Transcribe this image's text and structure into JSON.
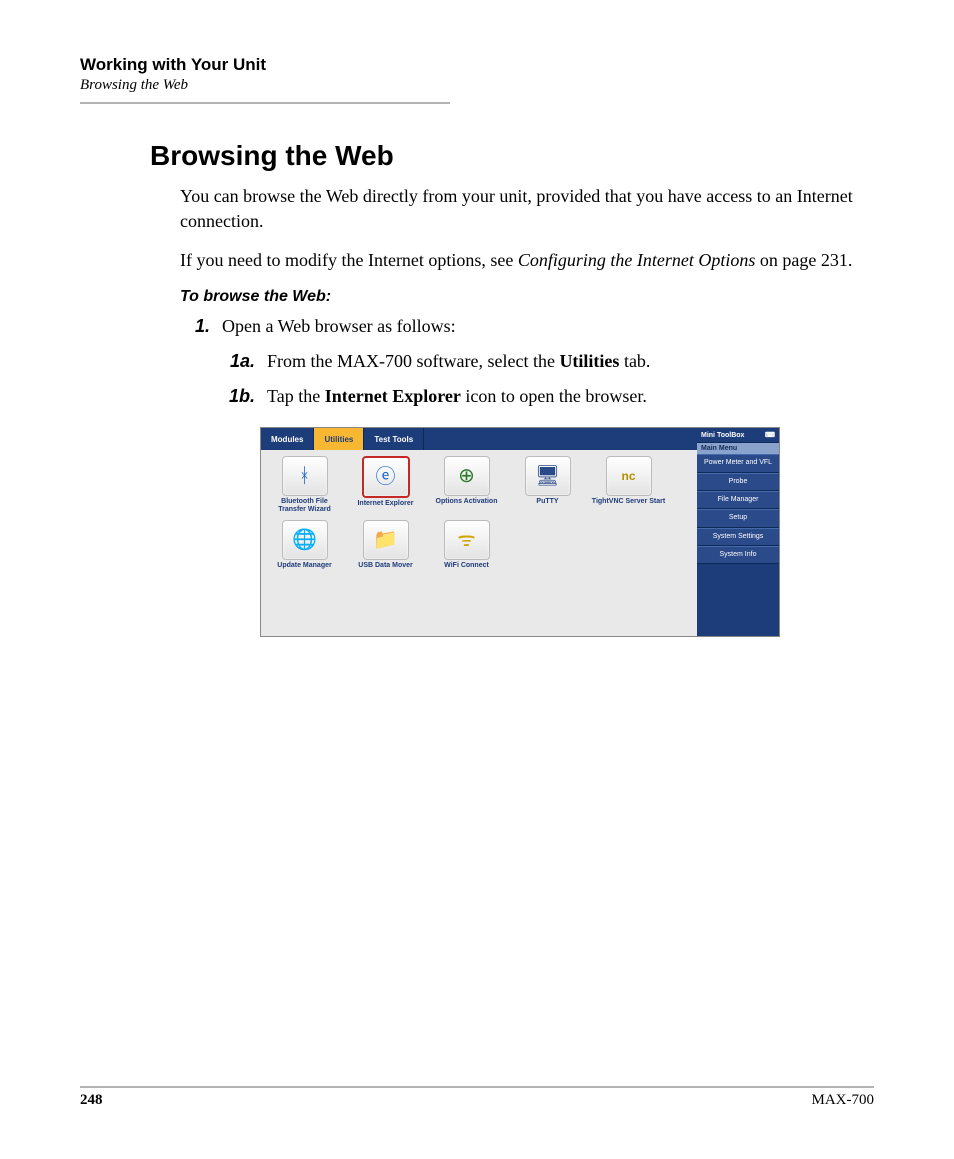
{
  "header": {
    "chapter": "Working with Your Unit",
    "section": "Browsing the Web"
  },
  "main": {
    "heading": "Browsing the Web",
    "intro1": "You can browse the Web directly from your unit, provided that you have access to an Internet connection.",
    "intro2a": "If you need to modify the Internet options, see ",
    "intro2_emph": "Configuring the Internet Options",
    "intro2b": " on page 231.",
    "task_heading": "To browse the Web:",
    "step1_num": "1.",
    "step1_text": "Open a Web browser as follows:",
    "step1a_num": "1a.",
    "step1a_a": "From the MAX-700 software, select the ",
    "step1a_bold": "Utilities",
    "step1a_b": " tab.",
    "step1b_num": "1b.",
    "step1b_a": "Tap the ",
    "step1b_bold": "Internet Explorer",
    "step1b_b": " icon to open the browser."
  },
  "screenshot": {
    "tabs": {
      "modules": "Modules",
      "utilities": "Utilities",
      "testtools": "Test Tools"
    },
    "apps": {
      "bt": "Bluetooth File Transfer Wizard",
      "ie": "Internet Explorer",
      "opt": "Options Activation",
      "putty": "PuTTY",
      "vnc": "TightVNC Server Start",
      "update": "Update Manager",
      "usb": "USB Data Mover",
      "wifi": "WiFi Connect"
    },
    "right": {
      "title": "Mini ToolBox",
      "menu": "Main Menu",
      "items": {
        "pm": "Power Meter and VFL",
        "probe": "Probe",
        "fm": "File Manager",
        "setup": "Setup",
        "ss": "System Settings",
        "si": "System Info"
      }
    }
  },
  "footer": {
    "page": "248",
    "model": "MAX-700"
  }
}
